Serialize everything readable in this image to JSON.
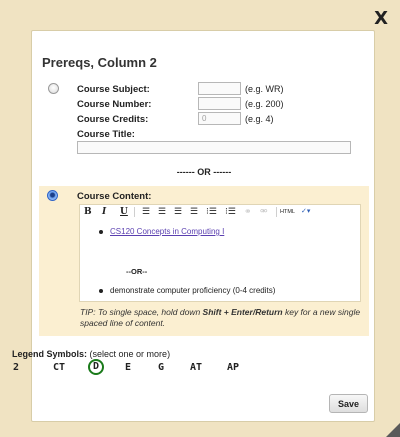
{
  "dialog": {
    "close_label": "X",
    "title": "Prereqs, Column 2"
  },
  "course_fields": {
    "subject_label": "Course Subject:",
    "subject_value": "",
    "subject_hint": "(e.g. WR)",
    "number_label": "Course Number:",
    "number_value": "",
    "number_hint": "(e.g. 200)",
    "credits_label": "Course Credits:",
    "credits_value": "0",
    "credits_hint": "(e.g. 4)",
    "title_label": "Course Title:",
    "title_value": ""
  },
  "separator": "------ OR ------",
  "course_content": {
    "label": "Course Content:",
    "toolbar": {
      "bold": "B",
      "italic": "I",
      "underline": "U",
      "html_label": "HTML"
    },
    "items": [
      {
        "type": "bullet-link",
        "text": "CS120 Concepts in Computing I"
      },
      {
        "type": "or",
        "text": "--OR--"
      },
      {
        "type": "bullet",
        "text": "demonstrate computer proficiency (0-4 credits)"
      }
    ],
    "tip": "TIP: To single space, hold down Shift + Enter/Return key for a new single spaced line of content."
  },
  "legend": {
    "label": "Legend Symbols:",
    "hint": "(select one or more)",
    "symbols": [
      "2",
      "CT",
      "D",
      "E",
      "G",
      "AT",
      "AP"
    ],
    "selected": "D"
  },
  "save_label": "Save",
  "colors": {
    "background": "#f0e3c2",
    "panel": "#fbefd1",
    "link": "#5a3fb0",
    "selected_ring": "#1a7a1a"
  }
}
